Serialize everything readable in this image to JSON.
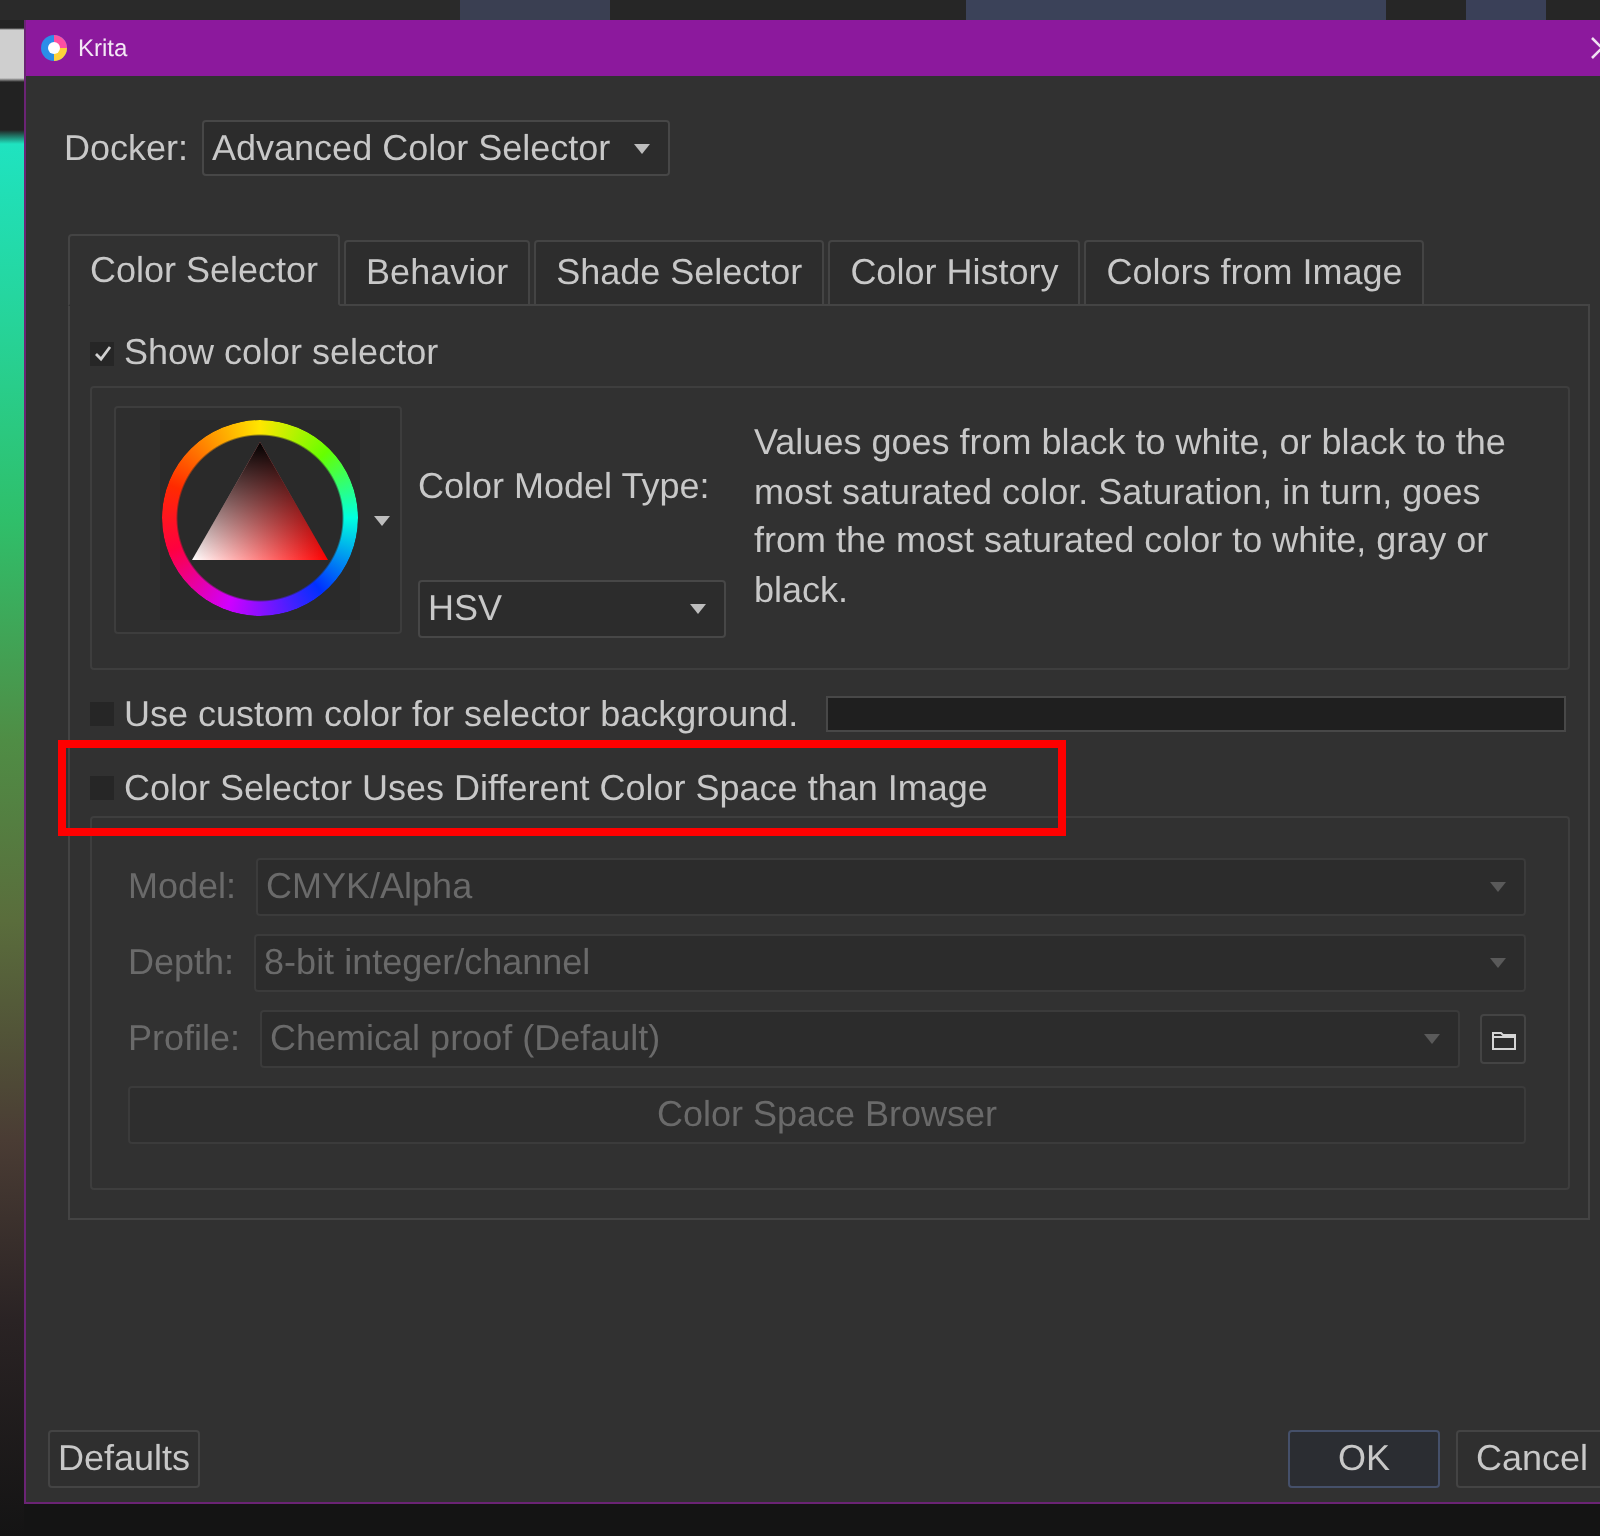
{
  "window": {
    "title": "Krita"
  },
  "docker": {
    "label": "Docker:",
    "value": "Advanced Color Selector"
  },
  "tabs": [
    {
      "label": "Color Selector",
      "selected": true
    },
    {
      "label": "Behavior",
      "selected": false
    },
    {
      "label": "Shade Selector",
      "selected": false
    },
    {
      "label": "Color History",
      "selected": false
    },
    {
      "label": "Colors from Image",
      "selected": false
    }
  ],
  "show_color_selector": {
    "label": "Show color selector",
    "checked": true
  },
  "color_model": {
    "label": "Color Model Type:",
    "value": "HSV",
    "description": "Values goes from black to white, or black to the most saturated color. Saturation, in turn, goes from the most saturated color to white, gray or black."
  },
  "custom_background": {
    "label": "Use custom color for selector background.",
    "checked": false
  },
  "different_color_space": {
    "label": "Color Selector Uses Different Color Space than Image",
    "checked": false,
    "highlighted": true
  },
  "color_space": {
    "disabled": true,
    "fields": [
      {
        "kind": "combo",
        "label": "Model:",
        "value": "CMYK/Alpha"
      },
      {
        "kind": "combo",
        "label": "Depth:",
        "value": "8-bit integer/channel"
      },
      {
        "kind": "browse",
        "label": "Profile:",
        "value": "Chemical proof (Default)"
      }
    ],
    "browser_button": "Color Space Browser"
  },
  "reset_button": {
    "label": "Defaults"
  },
  "buttons": [
    {
      "label": "OK",
      "default": true
    },
    {
      "label": "Cancel",
      "default": false
    }
  ]
}
